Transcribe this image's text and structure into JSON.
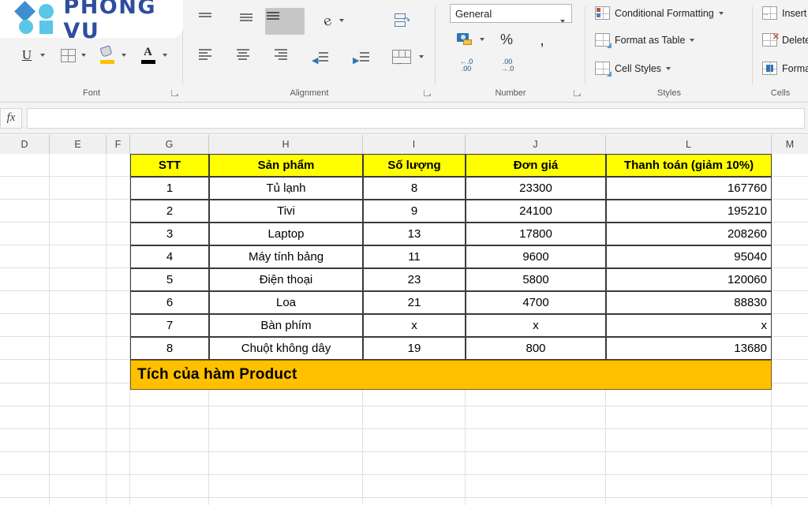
{
  "app": {
    "logo_text": "PHONG VU"
  },
  "ribbon": {
    "groups": [
      {
        "name": "Font",
        "label": "Font"
      },
      {
        "name": "Alignment",
        "label": "Alignment"
      },
      {
        "name": "Number",
        "label": "Number"
      },
      {
        "name": "Styles",
        "label": "Styles"
      },
      {
        "name": "Cells",
        "label": "Cells"
      }
    ],
    "font_group": {
      "underline": "U",
      "borders_icon": "borders-icon",
      "fill_color_icon": "fill-color-icon",
      "font_color_icon": "font-color-icon",
      "fill_color": "#ffc000",
      "font_color": "#000000"
    },
    "alignment_group": {
      "align_top": "align-top-icon",
      "align_middle": "align-middle-icon",
      "align_bottom": "align-bottom-icon",
      "orientation": "orientation-icon",
      "wrap_text": "wrap-text-icon",
      "align_left": "align-left-icon",
      "align_center": "align-center-icon",
      "align_right": "align-right-icon",
      "decrease_indent": "decrease-indent-icon",
      "increase_indent": "increase-indent-icon",
      "merge_center": "merge-and-center-icon",
      "selected": "align-bottom-icon"
    },
    "number_group": {
      "format_value": "General",
      "accounting_icon": "accounting-format-icon",
      "percent": "%",
      "comma": ",",
      "decrease_decimal": "decrease-decimal-icon",
      "increase_decimal": "increase-decimal-icon"
    },
    "styles_group": {
      "items": [
        {
          "label": "Conditional Formatting",
          "icon": "conditional-formatting-icon"
        },
        {
          "label": "Format as Table",
          "icon": "format-as-table-icon"
        },
        {
          "label": "Cell Styles",
          "icon": "cell-styles-icon"
        }
      ]
    },
    "cells_group": {
      "items": [
        {
          "label": "Insert",
          "icon": "insert-cells-icon"
        },
        {
          "label": "Delete",
          "icon": "delete-cells-icon"
        },
        {
          "label": "Format",
          "icon": "format-cells-icon"
        }
      ]
    }
  },
  "formula_bar": {
    "fx_label": "fx",
    "value": "",
    "placeholder": ""
  },
  "sheet": {
    "column_headers": [
      "D",
      "E",
      "F",
      "G",
      "H",
      "I",
      "J",
      "L",
      "M"
    ],
    "table": {
      "headers": [
        "STT",
        "Sản phẩm",
        "Số lượng",
        "Đơn giá",
        "Thanh toán (giảm 10%)"
      ],
      "rows": [
        {
          "stt": "1",
          "product": "Tủ lạnh",
          "qty": "8",
          "price": "23300",
          "total": "167760"
        },
        {
          "stt": "2",
          "product": "Tivi",
          "qty": "9",
          "price": "24100",
          "total": "195210"
        },
        {
          "stt": "3",
          "product": "Laptop",
          "qty": "13",
          "price": "17800",
          "total": "208260"
        },
        {
          "stt": "4",
          "product": "Máy tính bảng",
          "qty": "11",
          "price": "9600",
          "total": "95040"
        },
        {
          "stt": "5",
          "product": "Điện thoại",
          "qty": "23",
          "price": "5800",
          "total": "120060"
        },
        {
          "stt": "6",
          "product": "Loa",
          "qty": "21",
          "price": "4700",
          "total": "88830"
        },
        {
          "stt": "7",
          "product": "Bàn phím",
          "qty": "x",
          "price": "x",
          "total": "x"
        },
        {
          "stt": "8",
          "product": "Chuột không dây",
          "qty": "19",
          "price": "800",
          "total": "13680"
        }
      ],
      "banner": "Tích của hàm Product",
      "header_fill": "#ffff00",
      "banner_fill": "#ffc000"
    }
  }
}
